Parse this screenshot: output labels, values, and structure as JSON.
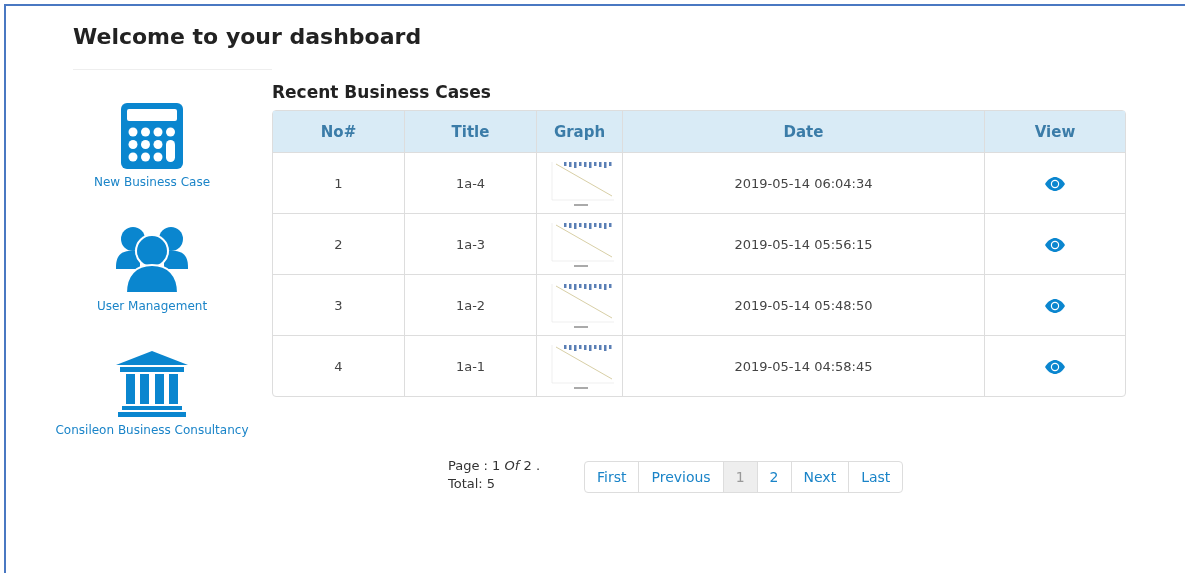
{
  "page_title": "Welcome to your dashboard",
  "sidebar": {
    "items": [
      {
        "label": "New Business Case",
        "kind": "calculator"
      },
      {
        "label": "User Management",
        "kind": "users"
      },
      {
        "label": "Consileon Business Consultancy",
        "kind": "bank"
      }
    ]
  },
  "section_title": "Recent Business Cases",
  "table": {
    "columns": [
      "No#",
      "Title",
      "Graph",
      "Date",
      "View"
    ],
    "rows": [
      {
        "no": "1",
        "title": "1a-4",
        "date": "2019-05-14 06:04:34"
      },
      {
        "no": "2",
        "title": "1a-3",
        "date": "2019-05-14 05:56:15"
      },
      {
        "no": "3",
        "title": "1a-2",
        "date": "2019-05-14 05:48:50"
      },
      {
        "no": "4",
        "title": "1a-1",
        "date": "2019-05-14 04:58:45"
      }
    ]
  },
  "pagination": {
    "page_info": "Page : 1  *Of* 2 .",
    "total": "Total: 5",
    "items": [
      {
        "label": "First",
        "selected": false
      },
      {
        "label": "Previous",
        "selected": false
      },
      {
        "label": "1",
        "selected": true
      },
      {
        "label": "2",
        "selected": false
      },
      {
        "label": "Next",
        "selected": false
      },
      {
        "label": "Last",
        "selected": false
      }
    ]
  }
}
